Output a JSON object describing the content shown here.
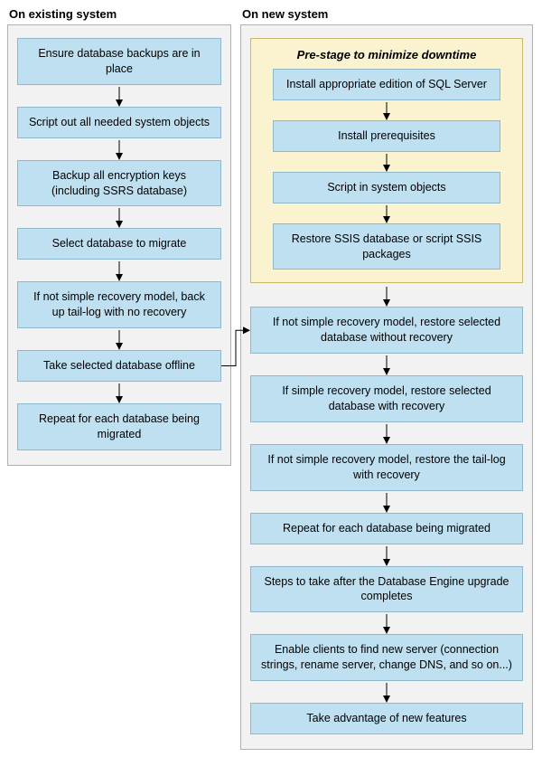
{
  "left": {
    "header": "On existing system",
    "steps": [
      "Ensure database backups are in place",
      "Script out all needed system objects",
      "Backup all encryption keys (including SSRS database)",
      "Select database to migrate",
      "If not simple recovery model, back up tail-log with no recovery",
      "Take selected database offline",
      "Repeat for each database being migrated"
    ]
  },
  "right": {
    "header": "On new system",
    "prestage_title": "Pre-stage to minimize downtime",
    "prestage_steps": [
      "Install appropriate edition of SQL Server",
      "Install prerequisites",
      "Script in system objects",
      "Restore SSIS database or script SSIS packages"
    ],
    "steps": [
      "If not simple recovery model, restore selected database without recovery",
      "If simple recovery model, restore selected database with recovery",
      "If not simple recovery model, restore the tail-log with recovery",
      "Repeat for each database being migrated",
      "Steps to take after the Database Engine upgrade completes",
      "Enable clients to find new server (connection strings, rename server, change DNS, and so on...)",
      "Take advantage of new features"
    ]
  }
}
